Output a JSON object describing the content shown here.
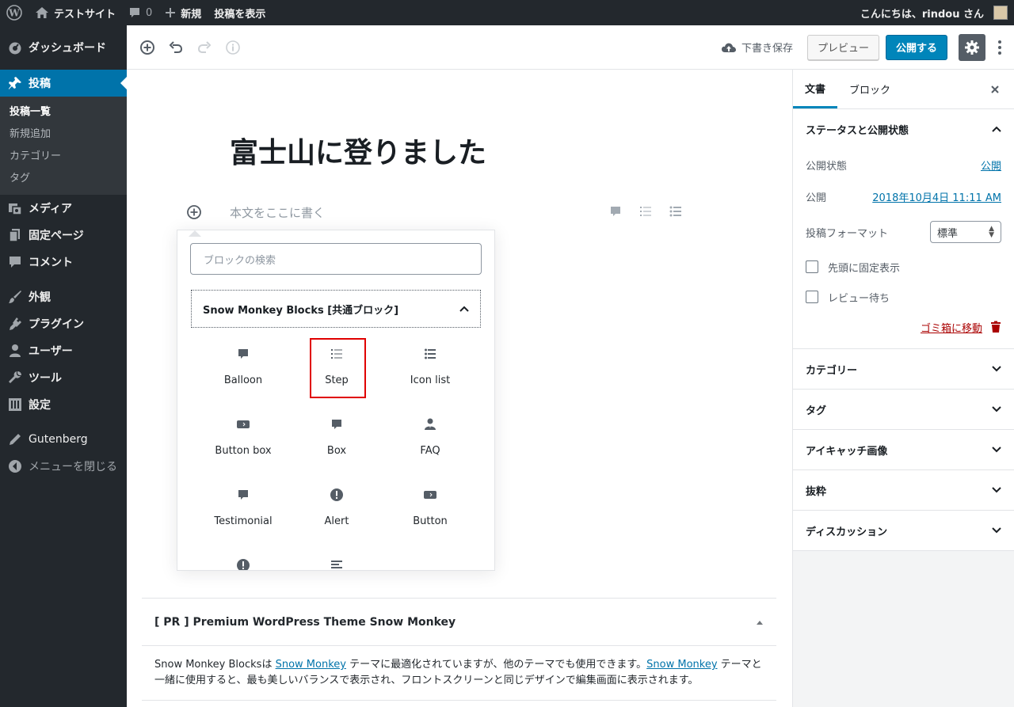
{
  "adminbar": {
    "site_name": "テストサイト",
    "comments_count": "0",
    "new_label": "新規",
    "view_post_label": "投稿を表示",
    "greeting": "こんにちは、rindou さん"
  },
  "sidebar": {
    "dashboard": "ダッシュボード",
    "posts": "投稿",
    "posts_submenu": [
      "投稿一覧",
      "新規追加",
      "カテゴリー",
      "タグ"
    ],
    "media": "メディア",
    "pages": "固定ページ",
    "comments": "コメント",
    "appearance": "外観",
    "plugins": "プラグイン",
    "users": "ユーザー",
    "tools": "ツール",
    "settings": "設定",
    "gutenberg": "Gutenberg",
    "collapse": "メニューを閉じる"
  },
  "header": {
    "save_draft": "下書き保存",
    "preview": "プレビュー",
    "publish": "公開する"
  },
  "editor": {
    "title": "富士山に登りました",
    "body_placeholder": "本文をここに書く"
  },
  "inserter": {
    "search_placeholder": "ブロックの検索",
    "panel_title": "Snow Monkey Blocks [共通ブロック]",
    "blocks": [
      {
        "label": "Balloon",
        "icon": "speech-bubble-icon"
      },
      {
        "label": "Step",
        "icon": "ordered-list-icon"
      },
      {
        "label": "Icon list",
        "icon": "bulleted-list-icon"
      },
      {
        "label": "Button box",
        "icon": "button-icon"
      },
      {
        "label": "Box",
        "icon": "speech-bubble-icon"
      },
      {
        "label": "FAQ",
        "icon": "person-icon"
      },
      {
        "label": "Testimonial",
        "icon": "speech-bubble-icon"
      },
      {
        "label": "Alert",
        "icon": "alert-icon"
      },
      {
        "label": "Button",
        "icon": "button-icon"
      },
      {
        "label": "",
        "icon": "alert-icon"
      },
      {
        "label": "",
        "icon": "align-left-icon"
      }
    ]
  },
  "metabox": {
    "title": "[ PR ] Premium WordPress Theme Snow Monkey",
    "text_1": "Snow Monkey Blocksは ",
    "link_1": "Snow Monkey",
    "text_2": " テーマに最適化されていますが、他のテーマでも使用できます。",
    "link_2": "Snow Monkey",
    "text_3": " テーマと一緒に使用すると、最も美しいバランスで表示され、フロントスクリーンと同じデザインで編集画面に表示されます。"
  },
  "settings": {
    "tab_document": "文書",
    "tab_block": "ブロック",
    "status_panel_title": "ステータスと公開状態",
    "visibility_label": "公開状態",
    "visibility_value": "公開",
    "publish_label": "公開",
    "publish_value": "2018年10月4日 11:11 AM",
    "format_label": "投稿フォーマット",
    "format_value": "標準",
    "sticky_label": "先頭に固定表示",
    "pending_label": "レビュー待ち",
    "trash_label": "ゴミ箱に移動",
    "panels": [
      "カテゴリー",
      "タグ",
      "アイキャッチ画像",
      "抜粋",
      "ディスカッション"
    ]
  },
  "colors": {
    "admin_dark": "#23282d",
    "admin_blue": "#0073aa",
    "publish_blue": "#0085ba",
    "highlight_red": "#e00000",
    "trash_red": "#a00000"
  }
}
